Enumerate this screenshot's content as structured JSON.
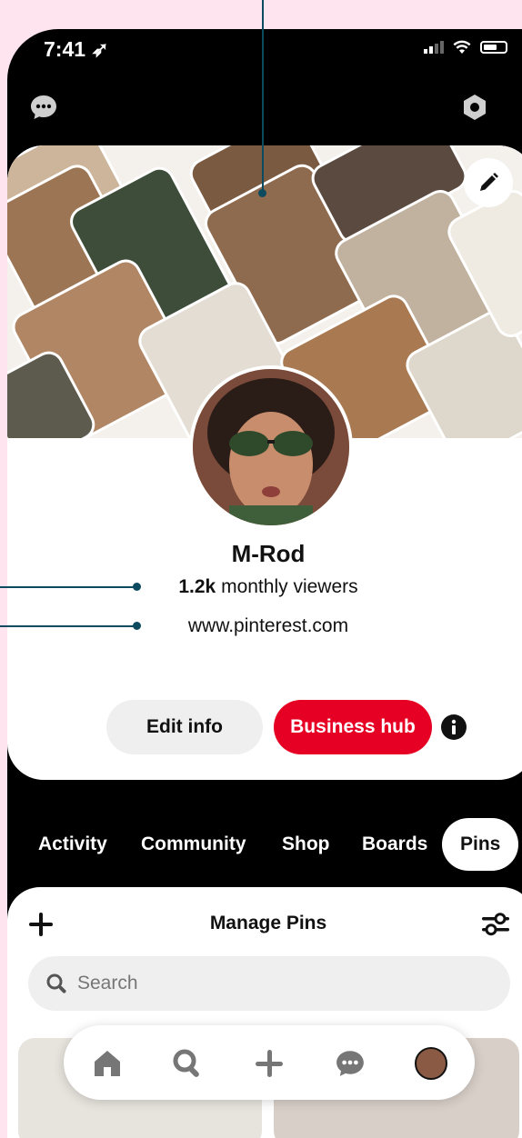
{
  "status_bar": {
    "time": "7:41"
  },
  "icons": {
    "messages": "speech-bubble-icon",
    "settings": "hexagon-gear-icon",
    "edit_cover": "pencil-icon",
    "info": "info-icon",
    "add": "plus-icon",
    "filter": "sliders-icon",
    "search": "search-icon"
  },
  "profile": {
    "name": "M-Rod",
    "viewers_count": "1.2k",
    "viewers_label": "monthly viewers",
    "website": "www.pinterest.com"
  },
  "buttons": {
    "edit_info": "Edit info",
    "business_hub": "Business hub"
  },
  "tabs": [
    {
      "label": "Activity"
    },
    {
      "label": "Community"
    },
    {
      "label": "Shop"
    },
    {
      "label": "Boards"
    },
    {
      "label": "Pins",
      "active": true
    }
  ],
  "pins_sheet": {
    "title": "Manage Pins",
    "search_placeholder": "Search"
  },
  "bottom_nav": {
    "items": [
      "home-icon",
      "search-icon",
      "plus-icon",
      "messages-icon",
      "profile-avatar"
    ]
  },
  "colors": {
    "background": "#fde4ee",
    "accent": "#e60023",
    "callout": "#0b4a5f"
  }
}
